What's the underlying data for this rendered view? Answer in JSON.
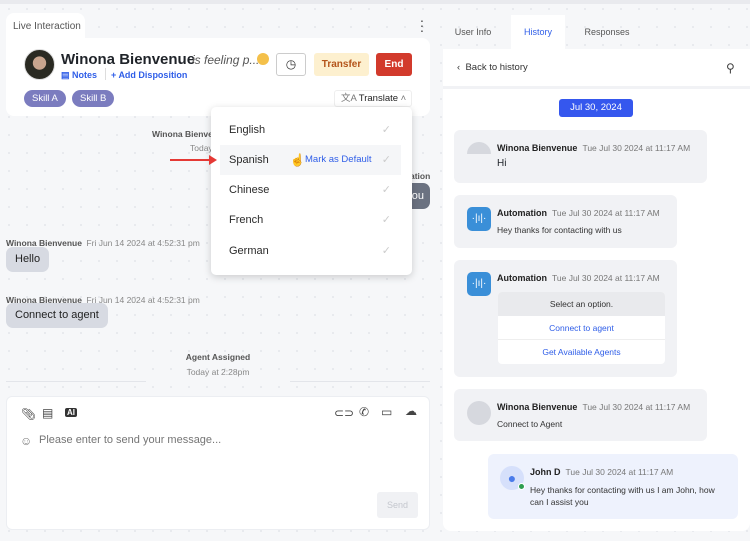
{
  "interaction": {
    "tab_label": "Live Interaction",
    "customer_name": "Winona Bienvenue",
    "feeling": "is feeling p...",
    "notes_label": "Notes",
    "add_disposition_label": "Add Disposition",
    "transfer_label": "Transfer",
    "end_label": "End",
    "skills": [
      "Skill A",
      "Skill B"
    ],
    "translate_label": "Translate"
  },
  "language_dropdown": {
    "options": [
      "English",
      "Spanish",
      "Chinese",
      "French",
      "German"
    ],
    "hovered": "Spanish",
    "mark_default_label": "Mark as Default"
  },
  "chat": {
    "hidden_sender": "Winona Bienve",
    "hidden_time": "Today",
    "hidden_right_sender": "ation",
    "hidden_right_text": "ou",
    "messages": [
      {
        "sender": "Winona Bienvenue",
        "time": "Fri Jun 14 2024 at 4:52:31 pm",
        "text": "Hello"
      },
      {
        "sender": "Winona Bienvenue",
        "time": "Fri Jun 14 2024 at 4:52:31 pm",
        "text": "Connect to agent"
      }
    ],
    "event_title": "Agent Assigned",
    "event_time": "Today at 2:28pm"
  },
  "composer": {
    "placeholder": "Please enter to send your message...",
    "send_label": "Send",
    "ai_label": "AI"
  },
  "right_panel": {
    "tabs": [
      "User Info",
      "History",
      "Responses"
    ],
    "active_tab": "History",
    "back_label": "Back to history",
    "date": "Jul 30, 2024",
    "messages": [
      {
        "sender": "Winona Bienvenue",
        "time": "Tue Jul 30 2024 at 11:17 AM",
        "text": "Hi"
      },
      {
        "sender": "Automation",
        "time": "Tue Jul 30 2024 at 11:17 AM",
        "text": "Hey thanks for contacting with us"
      },
      {
        "sender": "Automation",
        "time": "Tue Jul 30 2024 at 11:17 AM",
        "prompt": "Select an option.",
        "options": [
          "Connect to agent",
          "Get Available Agents"
        ]
      },
      {
        "sender": "Winona Bienvenue",
        "time": "Tue Jul 30 2024 at 11:17 AM",
        "text": "Connect to Agent"
      },
      {
        "sender": "John D",
        "time": "Tue Jul 30 2024 at 11:17 AM",
        "text": "Hey thanks for contacting with us I am John, how can I assist you"
      }
    ]
  },
  "colors": {
    "accent": "#3557ee",
    "end": "#d23a2c",
    "transfer_bg": "#fdf0cf",
    "skill": "#7b7cbf",
    "online": "#2e9e4f"
  }
}
